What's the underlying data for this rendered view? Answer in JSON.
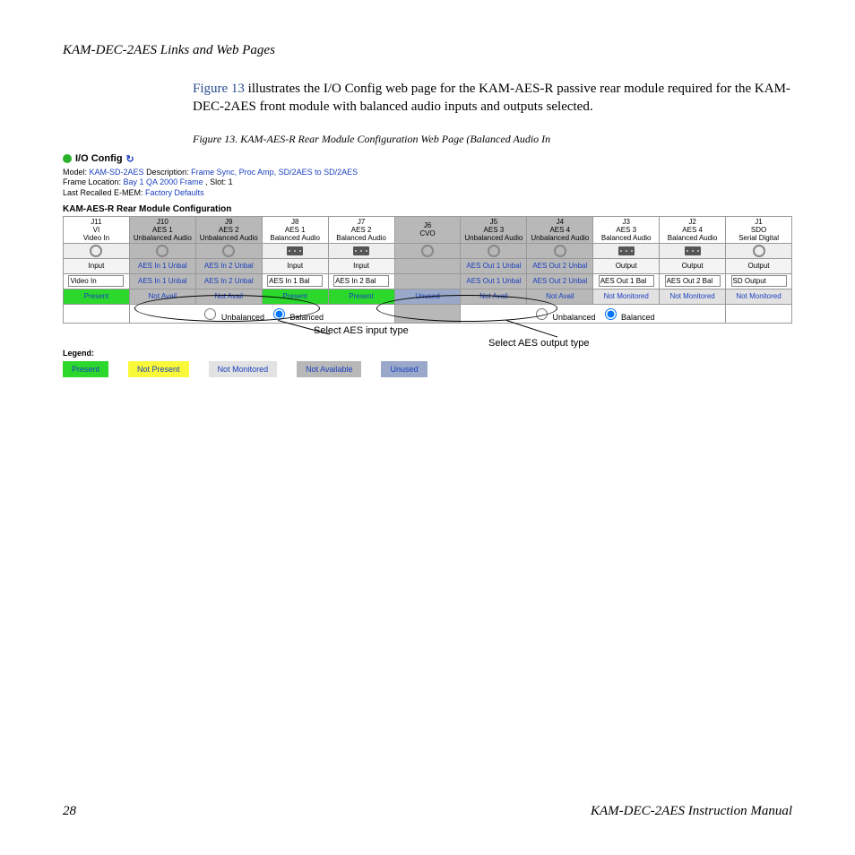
{
  "header": "KAM-DEC-2AES Links and Web Pages",
  "intro": {
    "figref": "Figure 13",
    "rest": " illustrates the I/O Config web page for the KAM-AES-R passive rear module required for the KAM-DEC-2AES front module with balanced audio inputs and outputs selected."
  },
  "figcap": "Figure 13.  KAM-AES-R Rear Module Configuration Web Page (Balanced Audio In",
  "ws": {
    "title_icon": "green-dot",
    "title": "I/O Config",
    "refresh": "↻",
    "meta": {
      "model_lbl": "Model:",
      "model": "KAM-SD-2AES",
      "desc_lbl": "Description:",
      "desc": "Frame Sync, Proc Amp, SD/2AES to SD/2AES",
      "frame_lbl": "Frame Location:",
      "frame": "Bay 1 QA 2000 Frame",
      "slot_lbl": ", Slot:",
      "slot": "1",
      "emem_lbl": "Last Recalled E-MEM:",
      "emem": "Factory Defaults"
    },
    "subtitle": "KAM-AES-R Rear Module Configuration",
    "cols": [
      {
        "h": "J11\nVI\nVideo In",
        "grey": false,
        "lbl": "Input",
        "field": "Video In",
        "stat": "Present",
        "statcls": "st-present",
        "icon": "bnc"
      },
      {
        "h": "J10\nAES 1\nUnbalanced Audio",
        "grey": true,
        "lbl": "",
        "lbltxt": "AES In 1 Unbal",
        "field": "",
        "stat": "Not Avail",
        "statcls": "st-notavail",
        "icon": "bnc"
      },
      {
        "h": "J9\nAES 2\nUnbalanced Audio",
        "grey": true,
        "lbl": "",
        "lbltxt": "AES In 2 Unbal",
        "field": "",
        "stat": "Not Avail",
        "statcls": "st-notavail",
        "icon": "bnc"
      },
      {
        "h": "J8\nAES 1\nBalanced Audio",
        "grey": false,
        "lbl": "Input",
        "field": "AES In 1 Bal",
        "stat": "Present",
        "statcls": "st-present",
        "icon": "bal"
      },
      {
        "h": "J7\nAES 2\nBalanced Audio",
        "grey": false,
        "lbl": "Input",
        "field": "AES In 2 Bal",
        "stat": "Present",
        "statcls": "st-present",
        "icon": "bal"
      },
      {
        "h": "J6\nCVO",
        "grey": true,
        "lbl": "",
        "field": "",
        "stat": "Unused",
        "statcls": "st-unused",
        "icon": "bnc"
      },
      {
        "h": "J5\nAES 3\nUnbalanced Audio",
        "grey": true,
        "lbl": "",
        "lbltxt": "AES Out 1 Unbal",
        "field": "",
        "stat": "Not Avail",
        "statcls": "st-notavail",
        "icon": "bnc"
      },
      {
        "h": "J4\nAES 4\nUnbalanced Audio",
        "grey": true,
        "lbl": "",
        "lbltxt": "AES Out 2 Unbal",
        "field": "",
        "stat": "Not Avail",
        "statcls": "st-notavail",
        "icon": "bnc"
      },
      {
        "h": "J3\nAES 3\nBalanced Audio",
        "grey": false,
        "lbl": "Output",
        "field": "AES Out 1 Bal",
        "stat": "Not Monitored",
        "statcls": "st-notmon",
        "icon": "bal"
      },
      {
        "h": "J2\nAES 4\nBalanced Audio",
        "grey": false,
        "lbl": "Output",
        "field": "AES Out 2 Bal",
        "stat": "Not Monitored",
        "statcls": "st-notmon",
        "icon": "bal"
      },
      {
        "h": "J1\nSDO\nSerial Digital",
        "grey": false,
        "lbl": "Output",
        "field": "SD Output",
        "stat": "Not Monitored",
        "statcls": "st-notmon",
        "icon": "bnc"
      }
    ],
    "radio": {
      "opt1": "Unbalanced",
      "opt2": "Balanced"
    }
  },
  "callouts": {
    "in": "Select AES input type",
    "out": "Select AES output type"
  },
  "legend": {
    "title": "Legend:",
    "items": [
      {
        "txt": "Present",
        "cls": "st-present"
      },
      {
        "txt": "Not Present",
        "cls": "st-notpresent"
      },
      {
        "txt": "Not Monitored",
        "cls": "st-notmon"
      },
      {
        "txt": "Not Available",
        "cls": "st-notavail"
      },
      {
        "txt": "Unused",
        "cls": "st-unused"
      }
    ]
  },
  "footer": {
    "page": "28",
    "title": "KAM-DEC-2AES Instruction Manual"
  }
}
